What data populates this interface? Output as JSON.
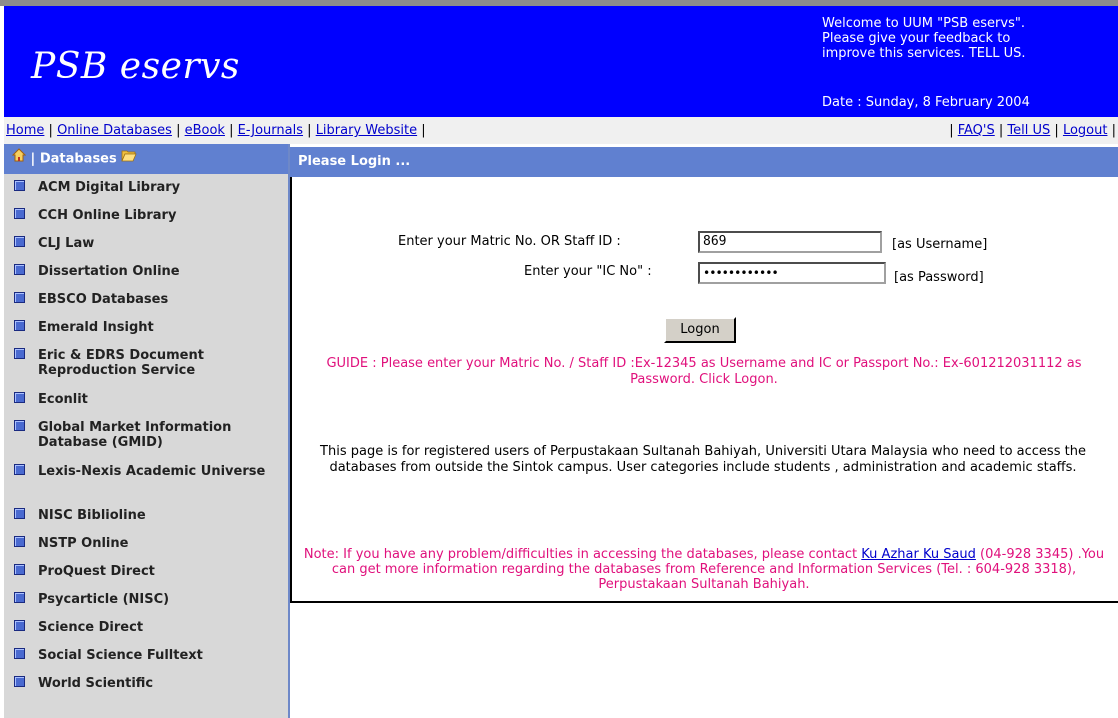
{
  "header": {
    "logo": "PSB eservs",
    "welcome_lines": [
      "Welcome to UUM \"PSB eservs\".",
      "Please give your feedback to",
      "improve this services.  TELL US."
    ],
    "date": "Date : Sunday, 8 February 2004"
  },
  "nav": {
    "left": [
      "Home",
      "Online Databases",
      "eBook",
      "E-Journals",
      "Library Website"
    ],
    "right": [
      "FAQ'S",
      "Tell US",
      "Logout"
    ]
  },
  "sidebar": {
    "title": "Databases",
    "items": [
      "ACM Digital Library",
      "CCH Online Library",
      "CLJ Law",
      "Dissertation Online",
      "EBSCO Databases",
      "Emerald Insight",
      "Eric & EDRS Document Reproduction Service",
      "Econlit",
      "Global Market Information Database (GMID)",
      "Lexis-Nexis Academic Universe",
      "NISC Biblioline",
      "NSTP Online",
      "ProQuest Direct",
      "Psycarticle (NISC)",
      "Science Direct",
      "Social Science Fulltext",
      "World Scientific"
    ]
  },
  "login": {
    "heading": "Please Login ...",
    "username_label": "Enter your Matric No. OR Staff ID :",
    "username_value": "869",
    "username_hint": "[as Username]",
    "password_label": "Enter your \"IC No\" :",
    "password_mask": "••••••••••••",
    "password_hint": "[as Password]",
    "button": "Logon"
  },
  "guide": "GUIDE : Please enter your Matric No. / Staff ID :Ex-12345 as Username and IC or Passport No.: Ex-601212031112 as Password. Click Logon.",
  "info": "This page is for registered users of  Perpustakaan Sultanah Bahiyah, Universiti Utara Malaysia who need to access the databases from outside the Sintok campus.  User categories include students , administration and academic staffs.",
  "note": {
    "before": "Note: If you have any problem/difficulties in accessing the databases, please contact ",
    "link": "Ku Azhar Ku Saud",
    "after": " (04-928 3345) .You can get more information regarding the  databases  from Reference and Information Services   (Tel. : 604-928 3318), Perpustakaan Sultanah Bahiyah."
  }
}
